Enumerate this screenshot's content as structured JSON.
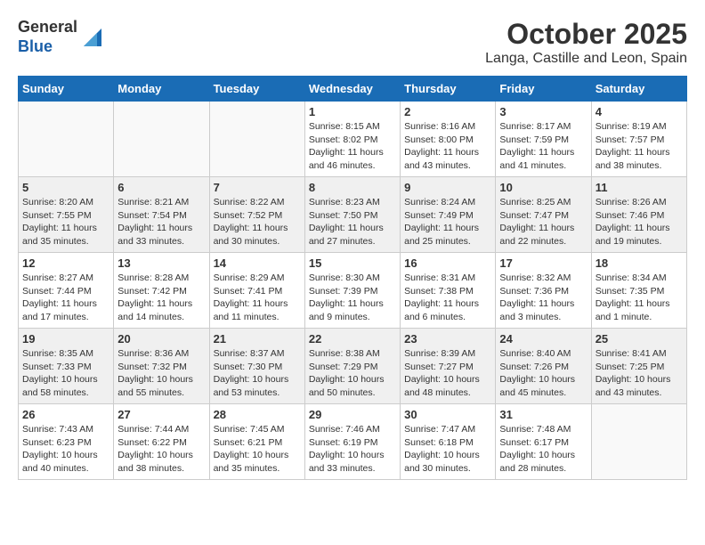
{
  "header": {
    "logo_general": "General",
    "logo_blue": "Blue",
    "month": "October 2025",
    "location": "Langa, Castille and Leon, Spain"
  },
  "days_of_week": [
    "Sunday",
    "Monday",
    "Tuesday",
    "Wednesday",
    "Thursday",
    "Friday",
    "Saturday"
  ],
  "weeks": [
    {
      "days": [
        {
          "num": "",
          "info": ""
        },
        {
          "num": "",
          "info": ""
        },
        {
          "num": "",
          "info": ""
        },
        {
          "num": "1",
          "info": "Sunrise: 8:15 AM\nSunset: 8:02 PM\nDaylight: 11 hours\nand 46 minutes."
        },
        {
          "num": "2",
          "info": "Sunrise: 8:16 AM\nSunset: 8:00 PM\nDaylight: 11 hours\nand 43 minutes."
        },
        {
          "num": "3",
          "info": "Sunrise: 8:17 AM\nSunset: 7:59 PM\nDaylight: 11 hours\nand 41 minutes."
        },
        {
          "num": "4",
          "info": "Sunrise: 8:19 AM\nSunset: 7:57 PM\nDaylight: 11 hours\nand 38 minutes."
        }
      ]
    },
    {
      "days": [
        {
          "num": "5",
          "info": "Sunrise: 8:20 AM\nSunset: 7:55 PM\nDaylight: 11 hours\nand 35 minutes."
        },
        {
          "num": "6",
          "info": "Sunrise: 8:21 AM\nSunset: 7:54 PM\nDaylight: 11 hours\nand 33 minutes."
        },
        {
          "num": "7",
          "info": "Sunrise: 8:22 AM\nSunset: 7:52 PM\nDaylight: 11 hours\nand 30 minutes."
        },
        {
          "num": "8",
          "info": "Sunrise: 8:23 AM\nSunset: 7:50 PM\nDaylight: 11 hours\nand 27 minutes."
        },
        {
          "num": "9",
          "info": "Sunrise: 8:24 AM\nSunset: 7:49 PM\nDaylight: 11 hours\nand 25 minutes."
        },
        {
          "num": "10",
          "info": "Sunrise: 8:25 AM\nSunset: 7:47 PM\nDaylight: 11 hours\nand 22 minutes."
        },
        {
          "num": "11",
          "info": "Sunrise: 8:26 AM\nSunset: 7:46 PM\nDaylight: 11 hours\nand 19 minutes."
        }
      ]
    },
    {
      "days": [
        {
          "num": "12",
          "info": "Sunrise: 8:27 AM\nSunset: 7:44 PM\nDaylight: 11 hours\nand 17 minutes."
        },
        {
          "num": "13",
          "info": "Sunrise: 8:28 AM\nSunset: 7:42 PM\nDaylight: 11 hours\nand 14 minutes."
        },
        {
          "num": "14",
          "info": "Sunrise: 8:29 AM\nSunset: 7:41 PM\nDaylight: 11 hours\nand 11 minutes."
        },
        {
          "num": "15",
          "info": "Sunrise: 8:30 AM\nSunset: 7:39 PM\nDaylight: 11 hours\nand 9 minutes."
        },
        {
          "num": "16",
          "info": "Sunrise: 8:31 AM\nSunset: 7:38 PM\nDaylight: 11 hours\nand 6 minutes."
        },
        {
          "num": "17",
          "info": "Sunrise: 8:32 AM\nSunset: 7:36 PM\nDaylight: 11 hours\nand 3 minutes."
        },
        {
          "num": "18",
          "info": "Sunrise: 8:34 AM\nSunset: 7:35 PM\nDaylight: 11 hours\nand 1 minute."
        }
      ]
    },
    {
      "days": [
        {
          "num": "19",
          "info": "Sunrise: 8:35 AM\nSunset: 7:33 PM\nDaylight: 10 hours\nand 58 minutes."
        },
        {
          "num": "20",
          "info": "Sunrise: 8:36 AM\nSunset: 7:32 PM\nDaylight: 10 hours\nand 55 minutes."
        },
        {
          "num": "21",
          "info": "Sunrise: 8:37 AM\nSunset: 7:30 PM\nDaylight: 10 hours\nand 53 minutes."
        },
        {
          "num": "22",
          "info": "Sunrise: 8:38 AM\nSunset: 7:29 PM\nDaylight: 10 hours\nand 50 minutes."
        },
        {
          "num": "23",
          "info": "Sunrise: 8:39 AM\nSunset: 7:27 PM\nDaylight: 10 hours\nand 48 minutes."
        },
        {
          "num": "24",
          "info": "Sunrise: 8:40 AM\nSunset: 7:26 PM\nDaylight: 10 hours\nand 45 minutes."
        },
        {
          "num": "25",
          "info": "Sunrise: 8:41 AM\nSunset: 7:25 PM\nDaylight: 10 hours\nand 43 minutes."
        }
      ]
    },
    {
      "days": [
        {
          "num": "26",
          "info": "Sunrise: 7:43 AM\nSunset: 6:23 PM\nDaylight: 10 hours\nand 40 minutes."
        },
        {
          "num": "27",
          "info": "Sunrise: 7:44 AM\nSunset: 6:22 PM\nDaylight: 10 hours\nand 38 minutes."
        },
        {
          "num": "28",
          "info": "Sunrise: 7:45 AM\nSunset: 6:21 PM\nDaylight: 10 hours\nand 35 minutes."
        },
        {
          "num": "29",
          "info": "Sunrise: 7:46 AM\nSunset: 6:19 PM\nDaylight: 10 hours\nand 33 minutes."
        },
        {
          "num": "30",
          "info": "Sunrise: 7:47 AM\nSunset: 6:18 PM\nDaylight: 10 hours\nand 30 minutes."
        },
        {
          "num": "31",
          "info": "Sunrise: 7:48 AM\nSunset: 6:17 PM\nDaylight: 10 hours\nand 28 minutes."
        },
        {
          "num": "",
          "info": ""
        }
      ]
    }
  ]
}
